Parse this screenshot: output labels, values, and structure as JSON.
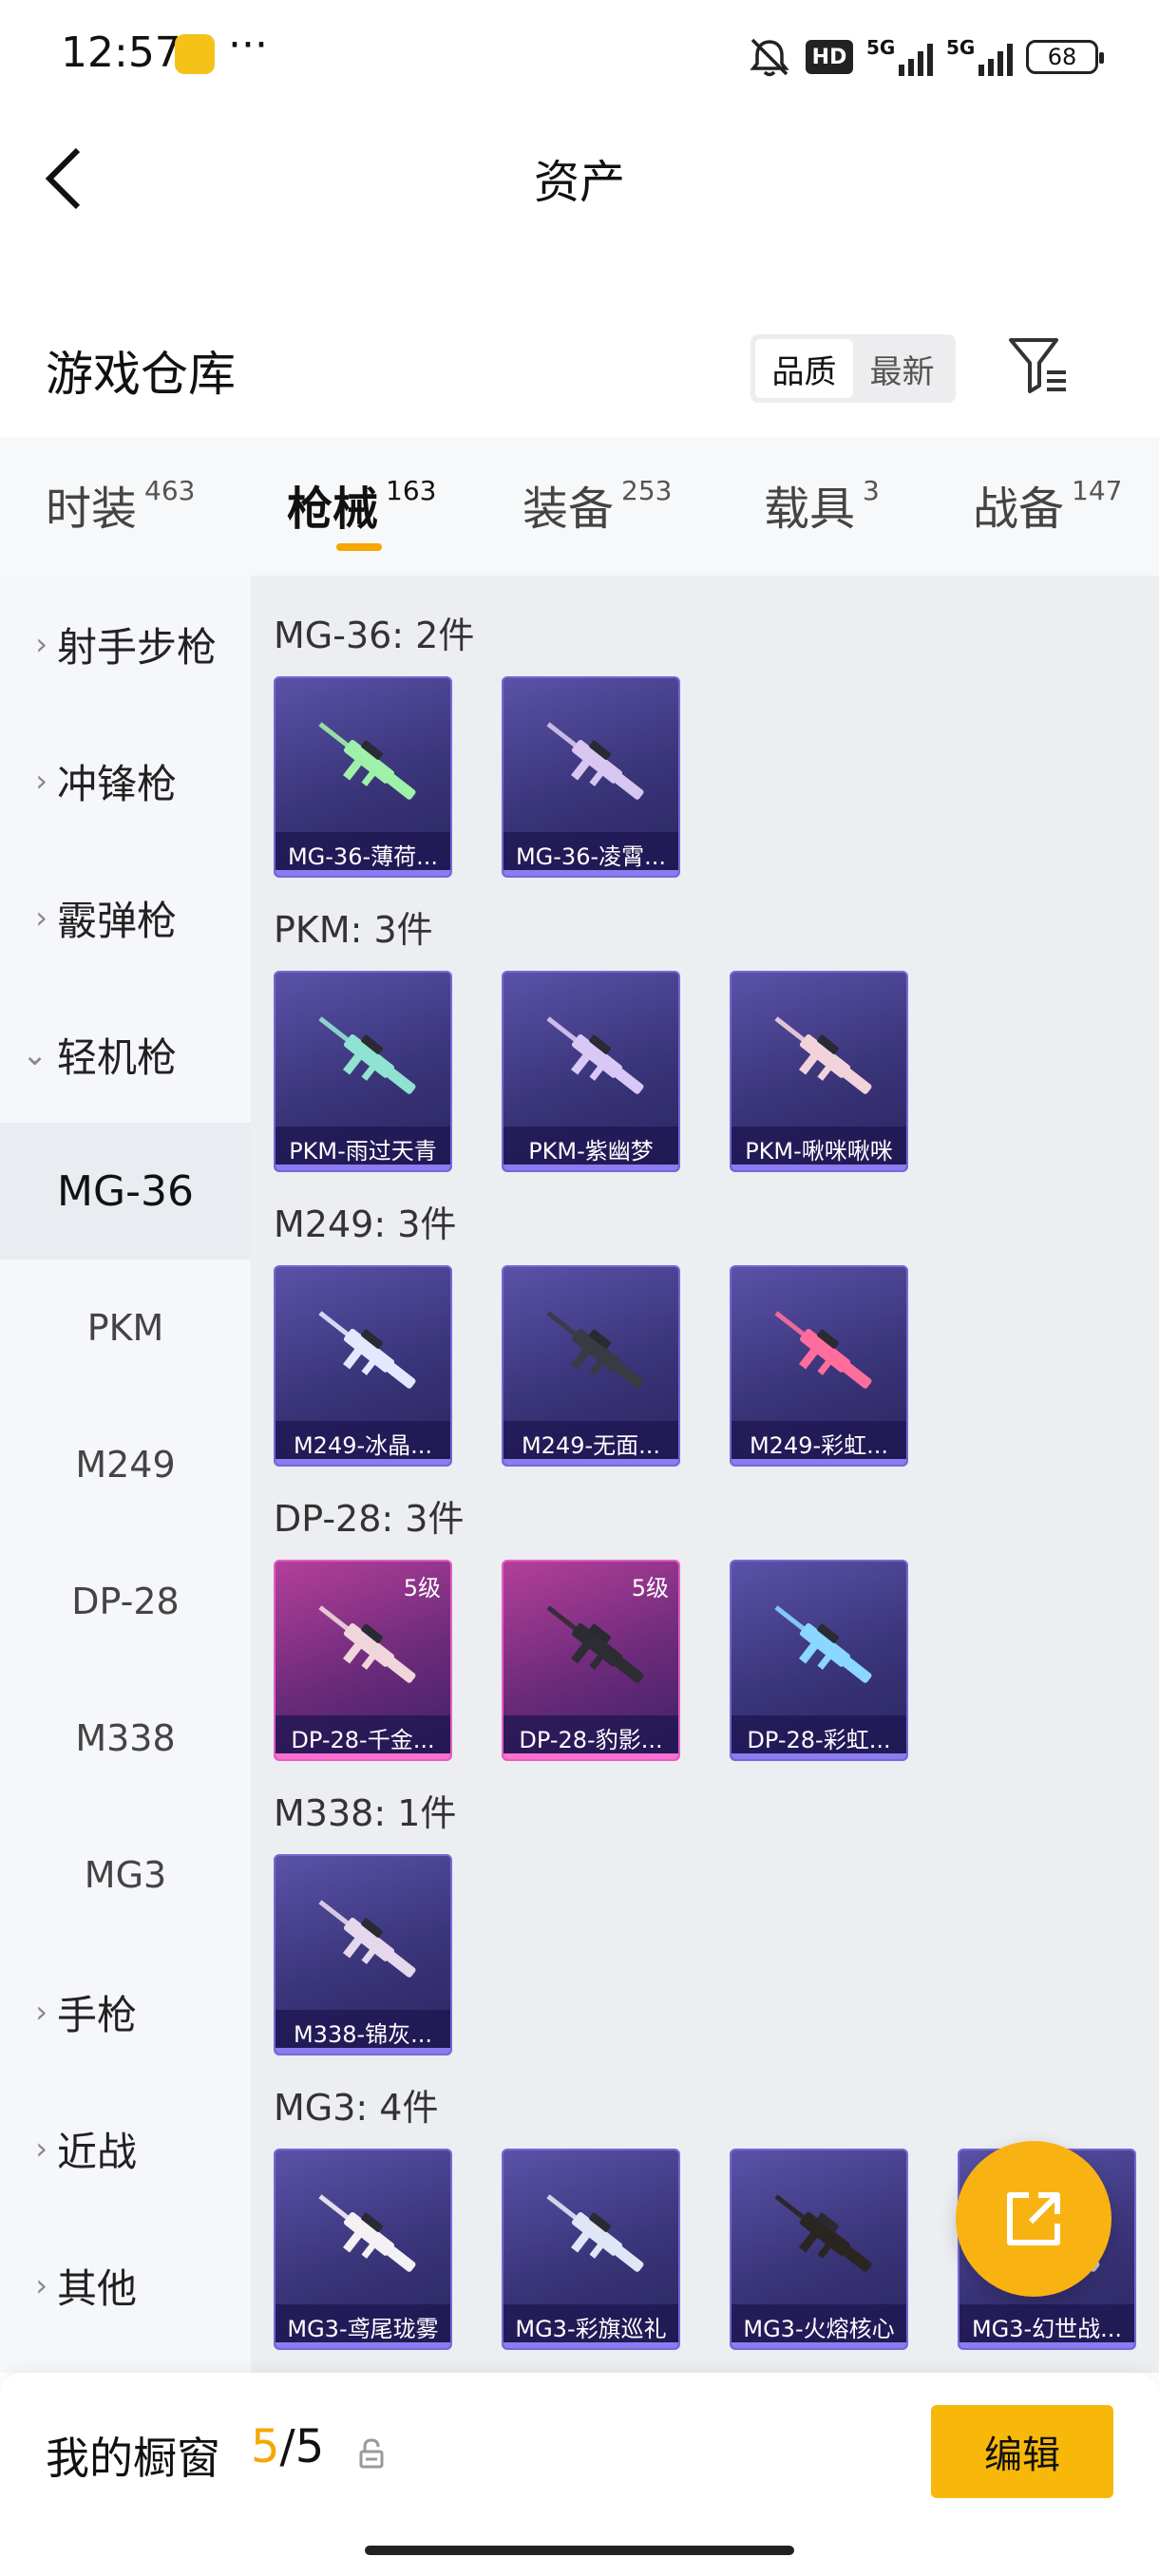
{
  "status_bar": {
    "time": "12:57",
    "dots": "···",
    "hd": "HD",
    "sig1": "5G",
    "sig2": "5G",
    "battery": "68"
  },
  "header": {
    "title": "资产"
  },
  "warehouse": {
    "title": "游戏仓库",
    "sort_options": [
      "品质",
      "最新"
    ],
    "active_sort": 0
  },
  "tabs": [
    {
      "label": "时装",
      "count": "463"
    },
    {
      "label": "枪械",
      "count": "163"
    },
    {
      "label": "装备",
      "count": "253"
    },
    {
      "label": "载具",
      "count": "3"
    },
    {
      "label": "战备",
      "count": "147"
    }
  ],
  "active_tab": 1,
  "sidebar": {
    "categories": [
      "射手步枪",
      "冲锋枪",
      "霰弹枪",
      "轻机枪"
    ],
    "expanded": "轻机枪",
    "subitems": [
      "MG-36",
      "PKM",
      "M249",
      "DP-28",
      "M338",
      "MG3"
    ],
    "active_sub": "MG-36",
    "more_categories": [
      "手枪",
      "近战",
      "其他"
    ]
  },
  "groups": [
    {
      "title": "MG-36: 2件",
      "items": [
        {
          "label": "MG-36-薄荷...",
          "gun_color": "#9ff0a8"
        },
        {
          "label": "MG-36-凌霄...",
          "gun_color": "#d7c6f0"
        }
      ]
    },
    {
      "title": "PKM: 3件",
      "items": [
        {
          "label": "PKM-雨过天青",
          "gun_color": "#8fe3d0"
        },
        {
          "label": "PKM-紫幽梦",
          "gun_color": "#d9c8f5"
        },
        {
          "label": "PKM-啾咪啾咪",
          "gun_color": "#f2d3dc"
        }
      ]
    },
    {
      "title": "M249: 3件",
      "items": [
        {
          "label": "M249-冰晶...",
          "gun_color": "#e4e8ff"
        },
        {
          "label": "M249-无面...",
          "gun_color": "#3a3a44"
        },
        {
          "label": "M249-彩虹...",
          "gun_color": "#ff6d9c"
        }
      ]
    },
    {
      "title": "DP-28: 3件",
      "items": [
        {
          "label": "DP-28-千金...",
          "gun_color": "#f0d6da",
          "level": "5级",
          "pink": true
        },
        {
          "label": "DP-28-豹影...",
          "gun_color": "#2c2c33",
          "level": "5级",
          "pink": true
        },
        {
          "label": "DP-28-彩虹...",
          "gun_color": "#8ad7ff"
        }
      ]
    },
    {
      "title": "M338: 1件",
      "items": [
        {
          "label": "M338-锦灰...",
          "gun_color": "#e6d8ec"
        }
      ]
    },
    {
      "title": "MG3: 4件",
      "items": [
        {
          "label": "MG3-鸢尾珑雾",
          "gun_color": "#f4f0f4"
        },
        {
          "label": "MG3-彩旗巡礼",
          "gun_color": "#dfe6f5"
        },
        {
          "label": "MG3-火熔核心",
          "gun_color": "#2a2520"
        },
        {
          "label": "MG3-幻世战...",
          "gun_color": "#c8c8d8"
        }
      ]
    }
  ],
  "showcase": {
    "label": "我的橱窗",
    "current": "5",
    "sep": "/",
    "total": "5",
    "edit_label": "编辑"
  },
  "colors": {
    "accent": "#f6a700",
    "card_purple": "#3a3479",
    "card_pink": "#b43f9a"
  }
}
